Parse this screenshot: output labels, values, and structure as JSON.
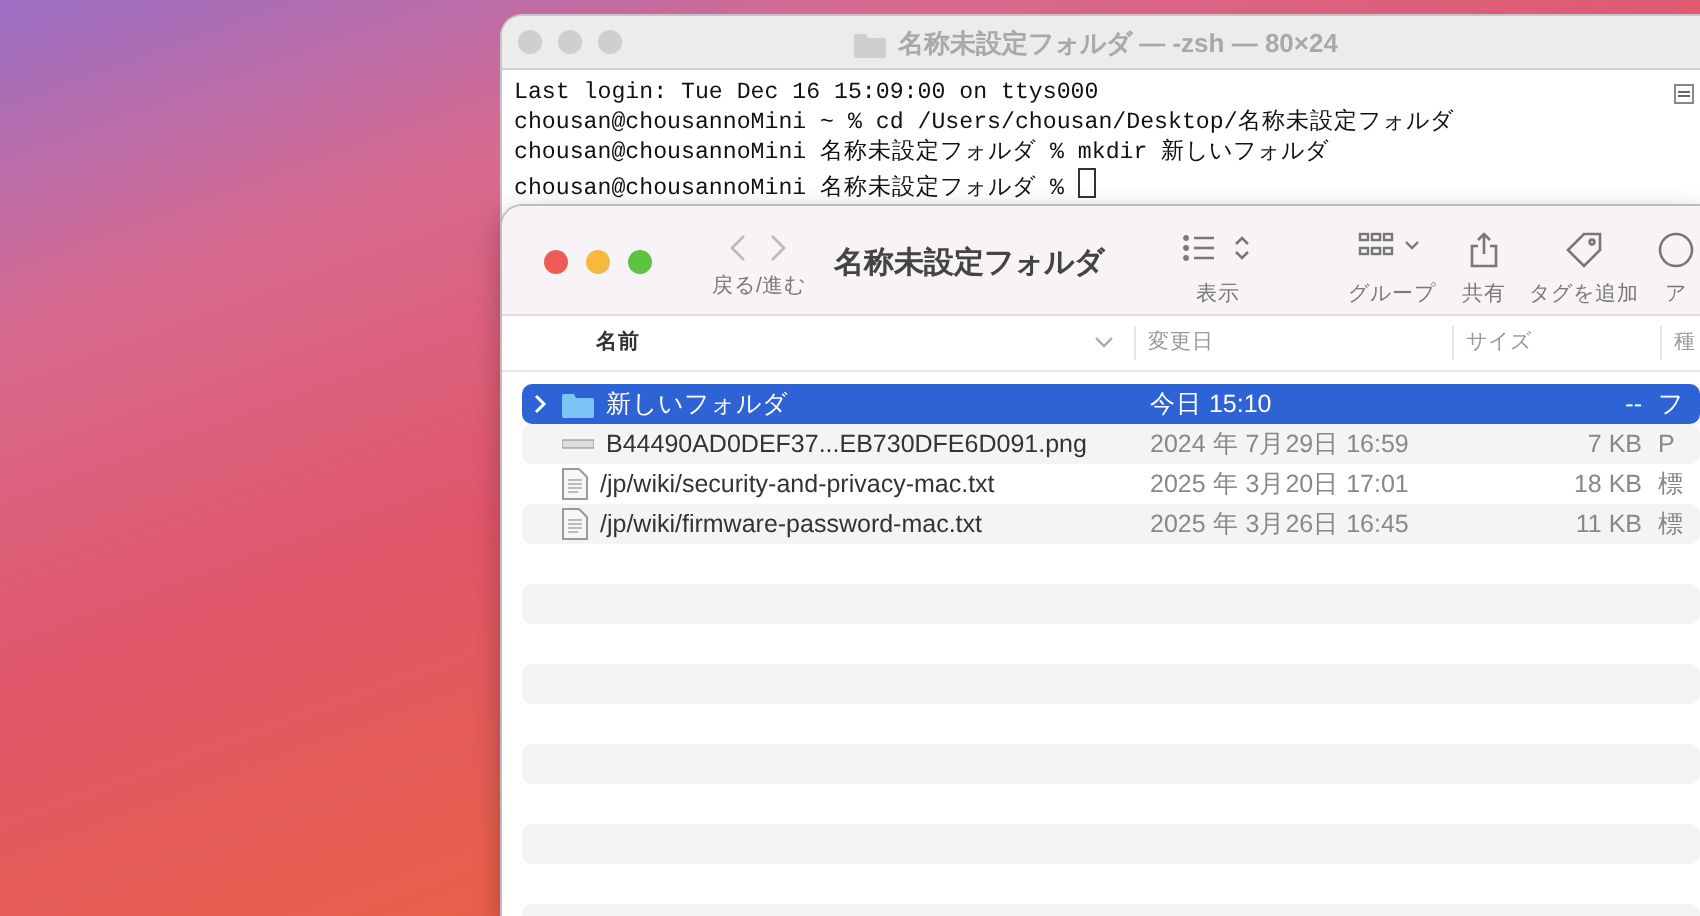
{
  "terminal": {
    "title": "名称未設定フォルダ — -zsh — 80×24",
    "lines": [
      "Last login: Tue Dec 16 15:09:00 on ttys000",
      "chousan@chousannoMini ~ % cd /Users/chousan/Desktop/名称未設定フォルダ",
      "chousan@chousannoMini 名称未設定フォルダ % mkdir 新しいフォルダ",
      "chousan@chousannoMini 名称未設定フォルダ % "
    ]
  },
  "finder": {
    "nav_label": "戻る/進む",
    "title": "名称未設定フォルダ",
    "toolbar": [
      {
        "kind": "view",
        "label": "表示"
      },
      {
        "kind": "group",
        "label": "グループ"
      },
      {
        "kind": "share",
        "label": "共有"
      },
      {
        "kind": "tag",
        "label": "タグを追加"
      },
      {
        "kind": "action",
        "label": "ア"
      }
    ],
    "columns": [
      "名前",
      "変更日",
      "サイズ",
      "種"
    ],
    "rows": [
      {
        "kind": "folder",
        "name": "新しいフォルダ",
        "date": "今日 15:10",
        "size": "--",
        "column_4": "フ",
        "selected": true,
        "expanded": false
      },
      {
        "kind": "image",
        "name": "B44490AD0DEF37...EB730DFE6D091.png",
        "date": "2024 年 7月29日 16:59",
        "size": "7 KB",
        "column_4": "P",
        "selected": false
      },
      {
        "kind": "text",
        "name": "/jp/wiki/security-and-privacy-mac.txt",
        "date": "2025 年 3月20日 17:01",
        "size": "18 KB",
        "column_4": "標",
        "selected": false
      },
      {
        "kind": "text",
        "name": "/jp/wiki/firmware-password-mac.txt",
        "date": "2025 年 3月26日 16:45",
        "size": "11 KB",
        "column_4": "標",
        "selected": false
      }
    ]
  }
}
